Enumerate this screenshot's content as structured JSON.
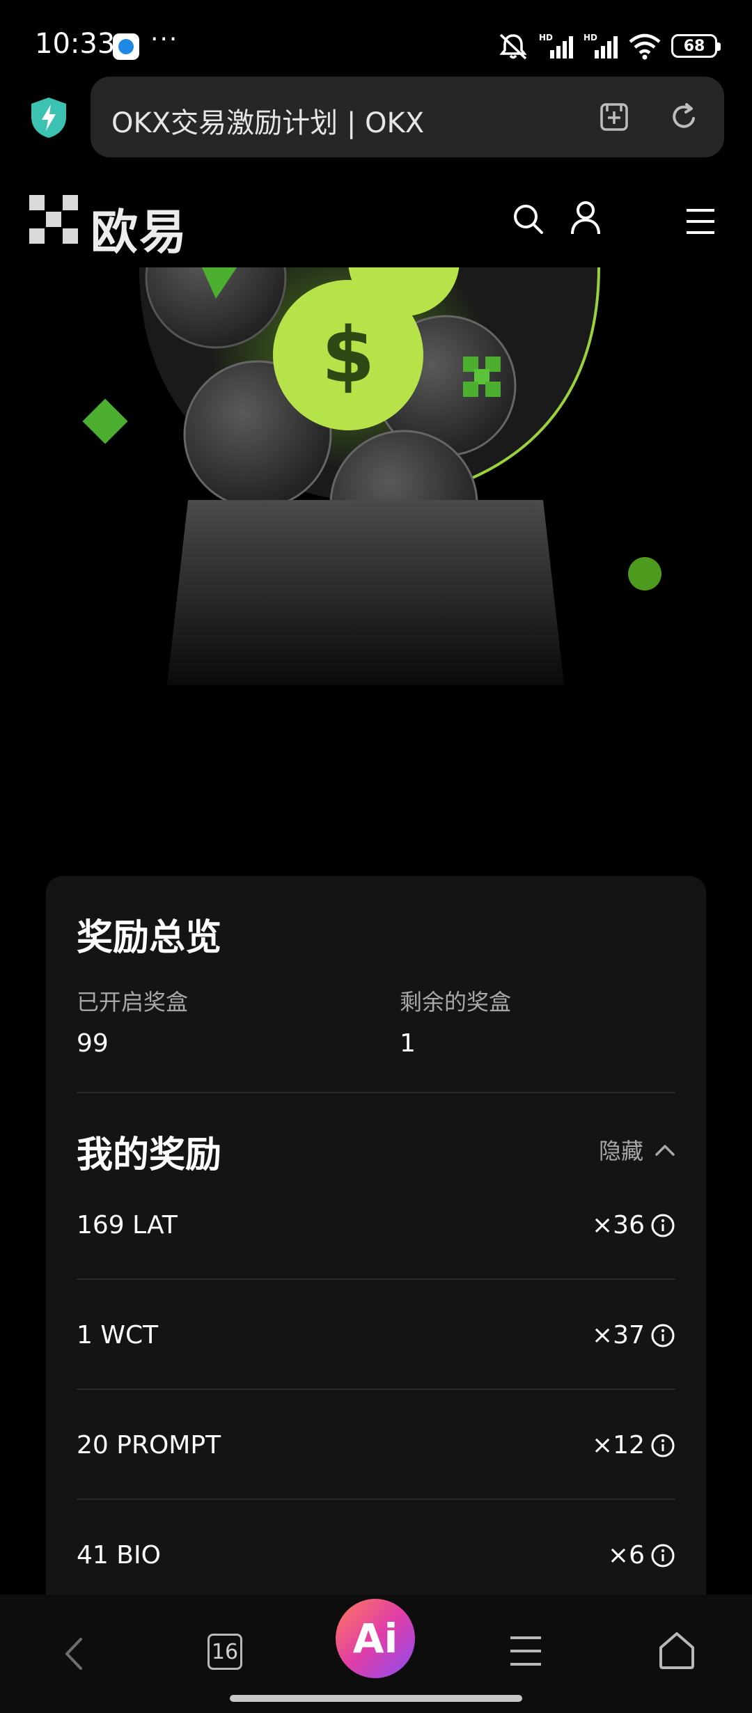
{
  "status_bar": {
    "time": "10:33",
    "battery": "68",
    "signal_labels": [
      "HD",
      "HD"
    ]
  },
  "browser": {
    "url_title": "OKX交易激励计划 | OKX",
    "icons": [
      "shield-bolt-icon",
      "bookmark-add-icon",
      "reload-icon"
    ]
  },
  "site_header": {
    "logo_text": "欧易",
    "icons": [
      "search-icon",
      "user-icon",
      "hamburger-menu-icon"
    ]
  },
  "hero": {
    "accent_color": "#9bd13c",
    "dollar_symbol": "$"
  },
  "overview": {
    "title": "奖励总览",
    "opened_label": "已开启奖盒",
    "opened_value": "99",
    "remaining_label": "剩余的奖盒",
    "remaining_value": "1"
  },
  "my_rewards": {
    "title": "我的奖励",
    "toggle_label": "隐藏",
    "items": [
      {
        "name": "169 LAT",
        "qty": "×36"
      },
      {
        "name": "1 WCT",
        "qty": "×37"
      },
      {
        "name": "20 PROMPT",
        "qty": "×12"
      },
      {
        "name": "41 BIO",
        "qty": "×6"
      }
    ]
  },
  "bottom_nav": {
    "tab_count": "16",
    "ai_label": "Ai"
  }
}
